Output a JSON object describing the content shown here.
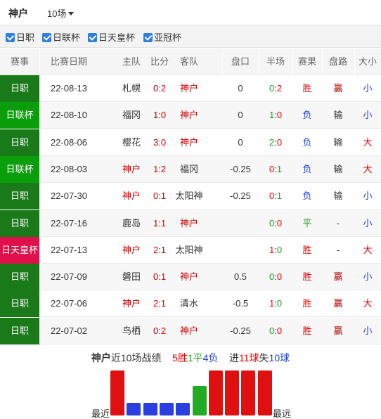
{
  "header": {
    "team": "神户",
    "count_selected": "10场"
  },
  "filters": [
    {
      "label": "日职",
      "checked": true
    },
    {
      "label": "日联杯",
      "checked": true
    },
    {
      "label": "日天皇杯",
      "checked": true
    },
    {
      "label": "亚冠杯",
      "checked": true
    }
  ],
  "table": {
    "columns": [
      "赛事",
      "比赛日期",
      "主队",
      "比分",
      "客队",
      "盘口",
      "半场",
      "赛果",
      "盘路",
      "大小"
    ],
    "rows": [
      {
        "league": "日职",
        "league_color": "#1a7a1a",
        "date": "22-08-13",
        "home": "札幌",
        "score_home": "0",
        "score_away": "2",
        "away": "神户",
        "handicap": "0",
        "ht_home": "0",
        "ht_away": "2",
        "result": "胜",
        "handicap_result": "赢",
        "ou": "小"
      },
      {
        "league": "日联杯",
        "league_color": "#0a9e0a",
        "date": "22-08-10",
        "home": "福冈",
        "score_home": "1",
        "score_away": "0",
        "away": "神户",
        "handicap": "0",
        "ht_home": "1",
        "ht_away": "0",
        "result": "负",
        "handicap_result": "输",
        "ou": "小"
      },
      {
        "league": "日职",
        "league_color": "#1a7a1a",
        "date": "22-08-06",
        "home": "樱花",
        "score_home": "3",
        "score_away": "0",
        "away": "神户",
        "handicap": "0",
        "ht_home": "2",
        "ht_away": "0",
        "result": "负",
        "handicap_result": "输",
        "ou": "大"
      },
      {
        "league": "日联杯",
        "league_color": "#0a9e0a",
        "date": "22-08-03",
        "home": "神户",
        "score_home": "1",
        "score_away": "2",
        "away": "福冈",
        "handicap": "-0.25",
        "ht_home": "0",
        "ht_away": "1",
        "result": "负",
        "handicap_result": "输",
        "ou": "大"
      },
      {
        "league": "日职",
        "league_color": "#1a7a1a",
        "date": "22-07-30",
        "home": "神户",
        "score_home": "0",
        "score_away": "1",
        "away": "太阳神",
        "handicap": "-0.25",
        "ht_home": "0",
        "ht_away": "1",
        "result": "负",
        "handicap_result": "输",
        "ou": "小"
      },
      {
        "league": "日职",
        "league_color": "#1a7a1a",
        "date": "22-07-16",
        "home": "鹿岛",
        "score_home": "1",
        "score_away": "1",
        "away": "神户",
        "handicap": "",
        "ht_home": "0",
        "ht_away": "0",
        "result": "平",
        "handicap_result": "-",
        "ou": "小"
      },
      {
        "league": "日天皇杯",
        "league_color": "#e0104a",
        "date": "22-07-13",
        "home": "神户",
        "score_home": "2",
        "score_away": "1",
        "away": "太阳神",
        "handicap": "",
        "ht_home": "1",
        "ht_away": "0",
        "result": "胜",
        "handicap_result": "-",
        "ou": "大"
      },
      {
        "league": "日职",
        "league_color": "#1a7a1a",
        "date": "22-07-09",
        "home": "磐田",
        "score_home": "0",
        "score_away": "1",
        "away": "神户",
        "handicap": "0.5",
        "ht_home": "0",
        "ht_away": "0",
        "result": "胜",
        "handicap_result": "赢",
        "ou": "小"
      },
      {
        "league": "日职",
        "league_color": "#1a7a1a",
        "date": "22-07-06",
        "home": "神户",
        "score_home": "2",
        "score_away": "1",
        "away": "清水",
        "handicap": "-0.5",
        "ht_home": "1",
        "ht_away": "0",
        "result": "胜",
        "handicap_result": "赢",
        "ou": "大"
      },
      {
        "league": "日职",
        "league_color": "#1a7a1a",
        "date": "22-07-02",
        "home": "鸟栖",
        "score_home": "0",
        "score_away": "2",
        "away": "神户",
        "handicap": "-0.25",
        "ht_home": "0",
        "ht_away": "0",
        "result": "胜",
        "handicap_result": "赢",
        "ou": "小"
      }
    ]
  },
  "summary": {
    "team": "神户",
    "prefix": "近10场战绩",
    "wins": "5胜",
    "draws": "1平",
    "losses": "4负",
    "scored_prefix": "进",
    "scored": "11球",
    "conceded_prefix": "失",
    "conceded": "10球"
  },
  "form_chart": {
    "label_recent": "最近",
    "label_far": "最远",
    "results": [
      "胜",
      "负",
      "负",
      "负",
      "负",
      "平",
      "胜",
      "胜",
      "胜",
      "胜"
    ],
    "colors": {
      "胜": "#e01010",
      "负": "#2b3fe0",
      "平": "#22aa22"
    }
  },
  "colors": {
    "win": "#e00000",
    "loss": "#1a3ee0",
    "draw": "#1a9c1a",
    "checkbox": "#2f7fe0"
  }
}
